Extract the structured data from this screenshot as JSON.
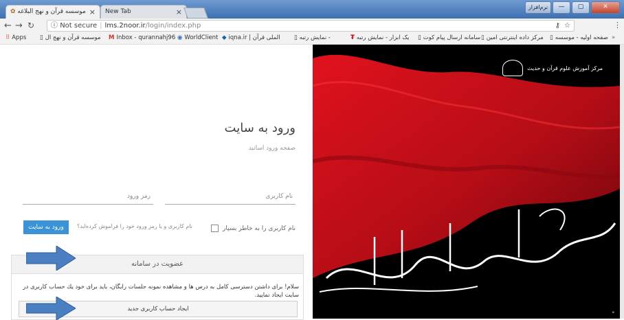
{
  "tabs": [
    {
      "title": "موسسه قرآن و نهج البلاغه",
      "active": true
    },
    {
      "title": "New Tab",
      "active": false
    }
  ],
  "window": {
    "user_label": "نرم‌افزار"
  },
  "toolbar": {
    "security_label": "Not secure",
    "url_host": "lms.2noor.ir",
    "url_path": "/login/index.php"
  },
  "bookmarks": [
    {
      "label": "Apps",
      "icon": "apps-icon"
    },
    {
      "label": "موسسه قرآن و نهج ال",
      "icon": "page-icon"
    },
    {
      "label": "Inbox - qurannahj96",
      "icon": "gmail-icon"
    },
    {
      "label": "WorldClient",
      "icon": "worldclient-icon"
    },
    {
      "label": "iqna.ir | الملی قرآن",
      "icon": "iqna-icon"
    },
    {
      "label": "نمایش رتبه -",
      "icon": "page-icon"
    },
    {
      "label": "یک ابزار - نمایش رتبه",
      "icon": "ebzar-icon"
    },
    {
      "label": "سامانه ارسال پیام کوت",
      "icon": "page-icon"
    },
    {
      "label": "مرکز داده اینترنتی امین",
      "icon": "page-icon"
    },
    {
      "label": "صفحه اولیه - موسسه",
      "icon": "page-icon"
    }
  ],
  "login": {
    "heading": "ورود به سایت",
    "subheading": "صفحه ورود اساتید",
    "username_placeholder": "نام کاربری",
    "password_placeholder": "رمز ورود",
    "remember_label": "نام کاربری را به خاطر بسپار",
    "forgot_label": "نام کاربری و یا رمز ورود خود را فراموش کرده‌اید؟",
    "submit_label": "ورود به سایت"
  },
  "register": {
    "header": "عضویت در سامانه",
    "text": "سلام! برای داشتن دسترسی کامل به درس ها و مشاهده نمونه جلسات رایگان، باید برای خود یك حساب کاربری در سایت ایجاد نمایید.",
    "button_label": "ایجاد حساب کاربری جدید"
  },
  "hero": {
    "logo_text": "مرکز آموزش علوم قرآن و حدیث",
    "calligraphy": "السلام علیک یا ابا عبدالله الحسین"
  },
  "colors": {
    "accent": "#3a93d6",
    "flag_red": "#c4101a",
    "annotation_arrow": "#4a7fc1"
  }
}
